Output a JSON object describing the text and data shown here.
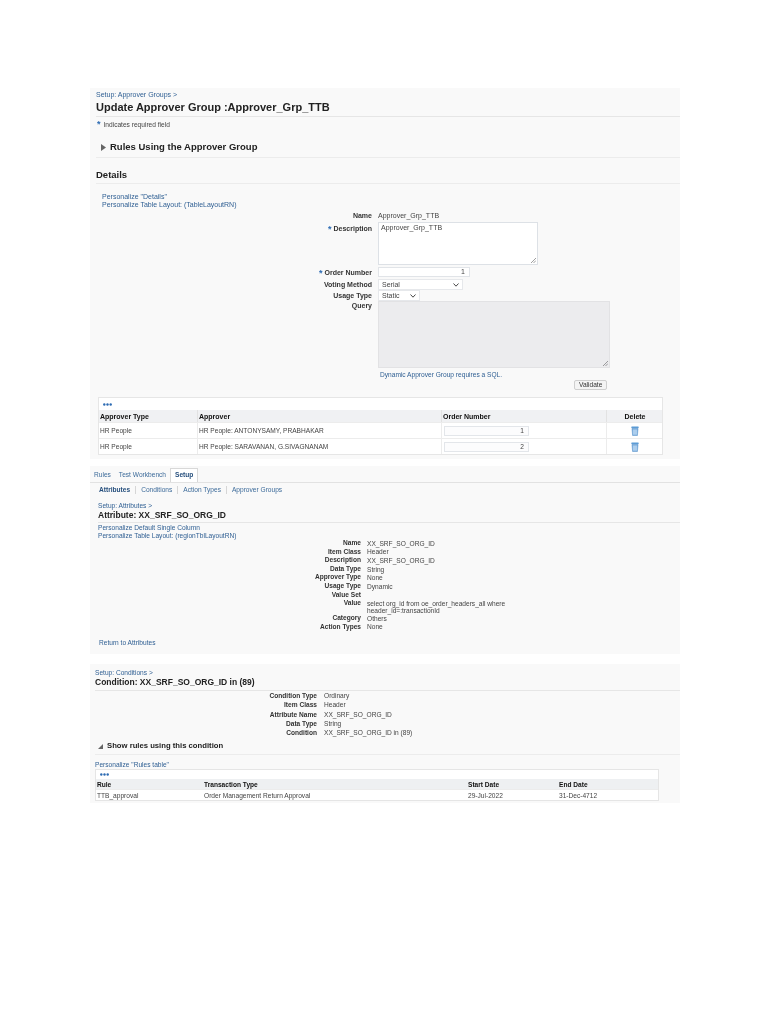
{
  "approver_group_page": {
    "breadcrumb": "Setup: Approver Groups >",
    "title": "Update Approver Group :Approver_Grp_TTB",
    "required_note": {
      "mark": "*",
      "text": "Indicates required field"
    },
    "rules_section": {
      "title": "Rules Using the Approver Group",
      "expanded": false
    },
    "details": {
      "title": "Details",
      "links": [
        "Personalize \"Details\"",
        "Personalize Table Layout: (TableLayoutRN)"
      ],
      "fields": [
        {
          "kind": "static",
          "label": "Name",
          "required": false,
          "disabled": false,
          "value": "Approver_Grp_TTB"
        },
        {
          "kind": "textarea",
          "label": "Description",
          "required": true,
          "disabled": false,
          "value": "Approver_Grp_TTB"
        },
        {
          "kind": "number",
          "label": "Order Number",
          "required": true,
          "disabled": false,
          "value": "1"
        },
        {
          "kind": "select",
          "label": "Voting Method",
          "required": false,
          "disabled": false,
          "value": "Serial"
        },
        {
          "kind": "select",
          "label": "Usage Type",
          "required": false,
          "disabled": false,
          "value": "Static"
        },
        {
          "kind": "query",
          "label": "Query",
          "required": false,
          "disabled": true
        }
      ],
      "hint": "Dynamic Approver Group requires a SQL.",
      "validate_button": "Validate"
    },
    "approvers_table": {
      "columns": [
        "Approver Type",
        "Approver",
        "Order Number",
        "Delete"
      ],
      "rows": [
        {
          "approver_type": "HR People",
          "approver": "HR People: ANTONYSAMY, PRABHAKAR",
          "order_number": "1"
        },
        {
          "approver_type": "HR People",
          "approver": "HR People: SARAVANAN, G.SIVAGNANAM",
          "order_number": "2"
        }
      ]
    }
  },
  "attribute_page": {
    "tabs": [
      {
        "label": "Rules",
        "selected": false
      },
      {
        "label": "Test Workbench",
        "selected": false
      },
      {
        "label": "Setup",
        "selected": true
      }
    ],
    "subtabs": [
      {
        "label": "Attributes",
        "selected": true
      },
      {
        "label": "Conditions",
        "selected": false
      },
      {
        "label": "Action Types",
        "selected": false
      },
      {
        "label": "Approver Groups",
        "selected": false
      }
    ],
    "breadcrumb": "Setup: Attributes >",
    "title": "Attribute: XX_SRF_SO_ORG_ID",
    "links": [
      "Personalize Default Single Column",
      "Personalize Table Layout: (regionTblLayoutRN)"
    ],
    "fields": [
      {
        "label": "Name",
        "value": "XX_SRF_SO_ORG_ID"
      },
      {
        "label": "Item Class",
        "value": "Header"
      },
      {
        "label": "Description",
        "value": "XX_SRF_SO_ORG_ID"
      },
      {
        "label": "Data Type",
        "value": "String"
      },
      {
        "label": "Approver Type",
        "value": "None"
      },
      {
        "label": "Usage Type",
        "value": "Dynamic"
      },
      {
        "label": "Value Set"
      },
      {
        "label": "Value",
        "value": "select org_id from oe_order_headers_all where header_id=:transactionId"
      },
      {
        "label": "Category",
        "value": "Others"
      },
      {
        "label": "Action Types",
        "value": "None"
      }
    ],
    "return_link": "Return to Attributes"
  },
  "condition_page": {
    "breadcrumb": "Setup: Conditions >",
    "title": "Condition: XX_SRF_SO_ORG_ID in (89)",
    "fields": [
      {
        "label": "Condition Type",
        "value": "Ordinary"
      },
      {
        "label": "Item Class",
        "value": "Header"
      },
      {
        "label": "Attribute Name",
        "value": "XX_SRF_SO_ORG_ID"
      },
      {
        "label": "Data Type",
        "value": "String"
      },
      {
        "label": "Condition",
        "value": "XX_SRF_SO_ORG_ID in (89)"
      }
    ],
    "rules_section": {
      "title": "Show rules using this condition",
      "expanded": true
    },
    "link": "Personalize \"Rules table\"",
    "rules_table": {
      "columns": [
        "Rule",
        "Transaction Type",
        "Start Date",
        "End Date"
      ],
      "rows": [
        {
          "rule": "TTB_approval",
          "transaction_type": "Order Management Return Approval",
          "start_date": "29-Jul-2022",
          "end_date": "31-Dec-4712"
        }
      ]
    }
  }
}
